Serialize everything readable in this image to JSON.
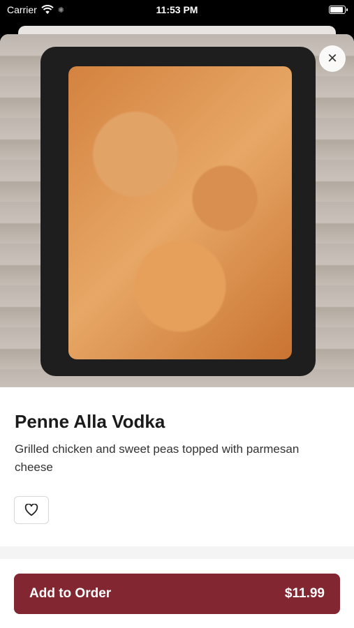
{
  "status_bar": {
    "carrier": "Carrier",
    "time": "11:53 PM"
  },
  "item": {
    "name": "Penne Alla Vodka",
    "description": "Grilled chicken and sweet peas topped with parmesan cheese"
  },
  "actions": {
    "close_glyph": "×",
    "add_label": "Add to Order",
    "price": "$11.99"
  },
  "colors": {
    "accent": "#822731"
  }
}
